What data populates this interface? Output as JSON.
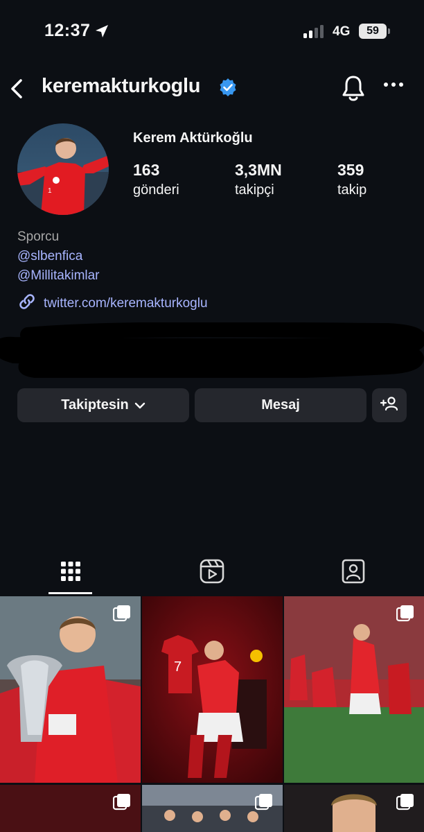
{
  "status_bar": {
    "time": "12:37",
    "network": "4G",
    "battery": "59"
  },
  "header": {
    "username": "keremakturkoglu"
  },
  "profile": {
    "full_name": "Kerem Aktürkoğlu",
    "stats": [
      {
        "value": "163",
        "label": "gönderi"
      },
      {
        "value": "3,3MN",
        "label": "takipçi"
      },
      {
        "value": "359",
        "label": "takip"
      }
    ],
    "category": "Sporcu",
    "mentions": [
      "@slbenfica",
      "@Millitakimlar"
    ],
    "link": "twitter.com/keremakturkoglu"
  },
  "buttons": {
    "following": "Takiptesin",
    "message": "Mesaj"
  },
  "tabs": [
    "grid",
    "reels",
    "tagged"
  ],
  "grid": {
    "items": [
      {
        "label": "trophy-photo",
        "multi": true
      },
      {
        "label": "benfica-jersey-photo",
        "multi": false
      },
      {
        "label": "celebration-photo",
        "multi": true
      },
      {
        "label": "post-4",
        "multi": true
      },
      {
        "label": "post-5",
        "multi": true
      },
      {
        "label": "post-6",
        "multi": true
      }
    ]
  },
  "colors": {
    "background": "#0c0f14",
    "link": "#a8b5ff",
    "verified": "#3897f0",
    "button": "#25272d"
  }
}
